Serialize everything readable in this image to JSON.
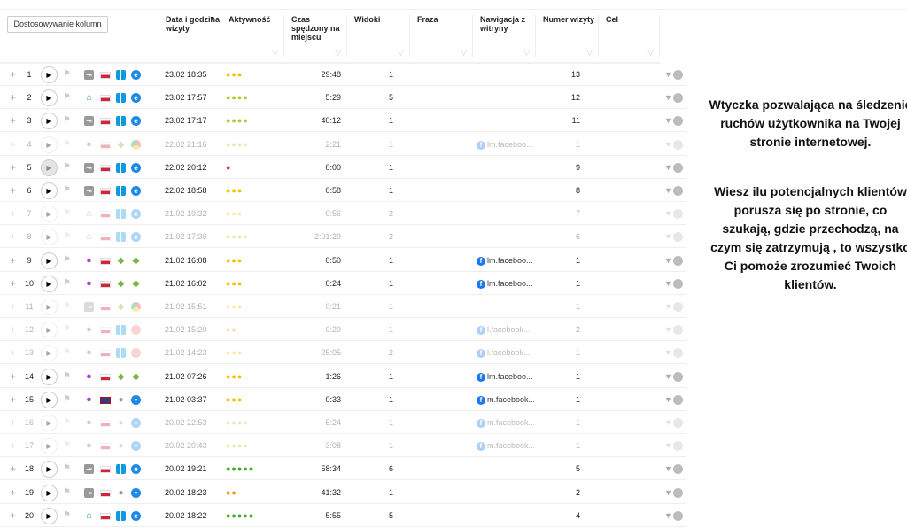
{
  "toolbar": {
    "customize_columns": "Dostosowywanie kolumn"
  },
  "columns": [
    "Data i godzina wizyty",
    "Aktywność",
    "Czas spędzony na miejscu",
    "Widoki",
    "Fraza",
    "Nawigacja z witryny",
    "Numer wizyty",
    "Cel"
  ],
  "colors": {
    "yellow": "#f2c200",
    "yellowgreen": "#b3c832",
    "red": "#e0392b",
    "orange": "#f09a00",
    "green": "#43a82a"
  },
  "rows": [
    {
      "n": "1",
      "faded": false,
      "src": "direct",
      "cty": "pl",
      "os": "win",
      "br": "ie",
      "date": "23.02 18:35",
      "dots": 3,
      "dc": "yellow",
      "time": "29:48",
      "views": "1",
      "nav": "",
      "visit": "13"
    },
    {
      "n": "2",
      "faded": false,
      "src": "home",
      "cty": "pl",
      "os": "win",
      "br": "ie",
      "date": "23.02 17:57",
      "dots": 4,
      "dc": "yellowgreen",
      "time": "5:29",
      "views": "5",
      "nav": "",
      "visit": "12"
    },
    {
      "n": "3",
      "faded": false,
      "src": "direct",
      "cty": "pl",
      "os": "win",
      "br": "ie",
      "date": "23.02 17:17",
      "dots": 4,
      "dc": "yellowgreen",
      "time": "40:12",
      "views": "1",
      "nav": "",
      "visit": "11"
    },
    {
      "n": "4",
      "faded": true,
      "src": "social",
      "cty": "pl",
      "os": "android",
      "br": "chrome",
      "date": "22.02 21:16",
      "dots": 4,
      "dc": "yellowgreen",
      "time": "2:21",
      "views": "1",
      "nav": "lm.faceboo...",
      "visit": "1"
    },
    {
      "n": "5",
      "faded": false,
      "greyplay": true,
      "src": "direct",
      "cty": "pl",
      "os": "win",
      "br": "ie",
      "date": "22.02 20:12",
      "dots": 1,
      "dc": "red",
      "time": "0:00",
      "views": "1",
      "nav": "",
      "visit": "9"
    },
    {
      "n": "6",
      "faded": false,
      "src": "direct",
      "cty": "pl",
      "os": "win",
      "br": "ie",
      "date": "22.02 18:58",
      "dots": 3,
      "dc": "yellow",
      "time": "0:58",
      "views": "1",
      "nav": "",
      "visit": "8"
    },
    {
      "n": "7",
      "faded": true,
      "src": "home",
      "cty": "pl",
      "os": "win",
      "br": "ie",
      "date": "21.02 19:32",
      "dots": 3,
      "dc": "yellow",
      "time": "0:56",
      "views": "2",
      "nav": "",
      "visit": "7"
    },
    {
      "n": "8",
      "faded": true,
      "src": "home",
      "cty": "pl",
      "os": "win",
      "br": "ie",
      "date": "21.02 17:30",
      "dots": 4,
      "dc": "yellowgreen",
      "time": "2:01:29",
      "views": "2",
      "nav": "",
      "visit": "6"
    },
    {
      "n": "9",
      "faded": false,
      "src": "social",
      "cty": "pl",
      "os": "android",
      "br": "android",
      "date": "21.02 16:08",
      "dots": 3,
      "dc": "yellow",
      "time": "0:50",
      "views": "1",
      "nav": "lm.faceboo...",
      "visit": "1"
    },
    {
      "n": "10",
      "faded": false,
      "src": "social",
      "cty": "pl",
      "os": "android",
      "br": "android",
      "date": "21.02 16:02",
      "dots": 3,
      "dc": "yellow",
      "time": "0:24",
      "views": "1",
      "nav": "lm.faceboo...",
      "visit": "1"
    },
    {
      "n": "11",
      "faded": true,
      "src": "direct",
      "cty": "pl",
      "os": "android",
      "br": "chrome",
      "date": "21.02 15:51",
      "dots": 3,
      "dc": "yellow",
      "time": "0:21",
      "views": "1",
      "nav": "",
      "visit": "1"
    },
    {
      "n": "12",
      "faded": true,
      "src": "social",
      "cty": "pl",
      "os": "win",
      "br": "opera",
      "date": "21.02 15:20",
      "dots": 2,
      "dc": "orange",
      "time": "0:29",
      "views": "1",
      "nav": "l.facebook...",
      "visit": "2"
    },
    {
      "n": "13",
      "faded": true,
      "src": "social",
      "cty": "pl",
      "os": "win",
      "br": "opera",
      "date": "21.02 14:23",
      "dots": 3,
      "dc": "yellow",
      "time": "25:05",
      "views": "2",
      "nav": "l.facebook...",
      "visit": "1"
    },
    {
      "n": "14",
      "faded": false,
      "src": "social",
      "cty": "pl",
      "os": "android",
      "br": "android",
      "date": "21.02 07:26",
      "dots": 3,
      "dc": "yellow",
      "time": "1:26",
      "views": "1",
      "nav": "lm.faceboo...",
      "visit": "1"
    },
    {
      "n": "15",
      "faded": false,
      "src": "social",
      "cty": "uk",
      "os": "apple",
      "br": "safari",
      "date": "21.02 03:37",
      "dots": 3,
      "dc": "yellow",
      "time": "0:33",
      "views": "1",
      "nav": "m.facebook...",
      "visit": "1"
    },
    {
      "n": "16",
      "faded": true,
      "src": "social",
      "cty": "pl",
      "os": "apple",
      "br": "safari",
      "date": "20.02 22:53",
      "dots": 4,
      "dc": "yellowgreen",
      "time": "5:24",
      "views": "1",
      "nav": "m.facebook...",
      "visit": "1"
    },
    {
      "n": "17",
      "faded": true,
      "src": "social",
      "cty": "pl",
      "os": "apple",
      "br": "safari",
      "date": "20.02 20:43",
      "dots": 4,
      "dc": "yellowgreen",
      "time": "3:08",
      "views": "1",
      "nav": "m.facebook...",
      "visit": "1"
    },
    {
      "n": "18",
      "faded": false,
      "src": "direct",
      "cty": "pl",
      "os": "win",
      "br": "ie",
      "date": "20.02 19:21",
      "dots": 5,
      "dc": "green",
      "time": "58:34",
      "views": "6",
      "nav": "",
      "visit": "5"
    },
    {
      "n": "19",
      "faded": false,
      "src": "direct",
      "cty": "pl",
      "os": "apple",
      "br": "safari",
      "date": "20.02 18:23",
      "dots": 2,
      "dc": "orange",
      "time": "41:32",
      "views": "1",
      "nav": "",
      "visit": "2"
    },
    {
      "n": "20",
      "faded": false,
      "src": "home",
      "cty": "pl",
      "os": "win",
      "br": "ie",
      "date": "20.02 18:22",
      "dots": 5,
      "dc": "green",
      "time": "5:55",
      "views": "5",
      "nav": "",
      "visit": "4"
    }
  ],
  "overlay": {
    "p1": "Wtyczka pozwalająca na śledzenie ruchów użytkownika na Twojej stronie internetowej.",
    "p2": "Wiesz ilu potencjalnych klientów porusza się po stronie, co szukają, gdzie przechodzą, na czym się zatrzymują , to wszystko Ci pomoże zrozumieć Twoich klientów."
  }
}
